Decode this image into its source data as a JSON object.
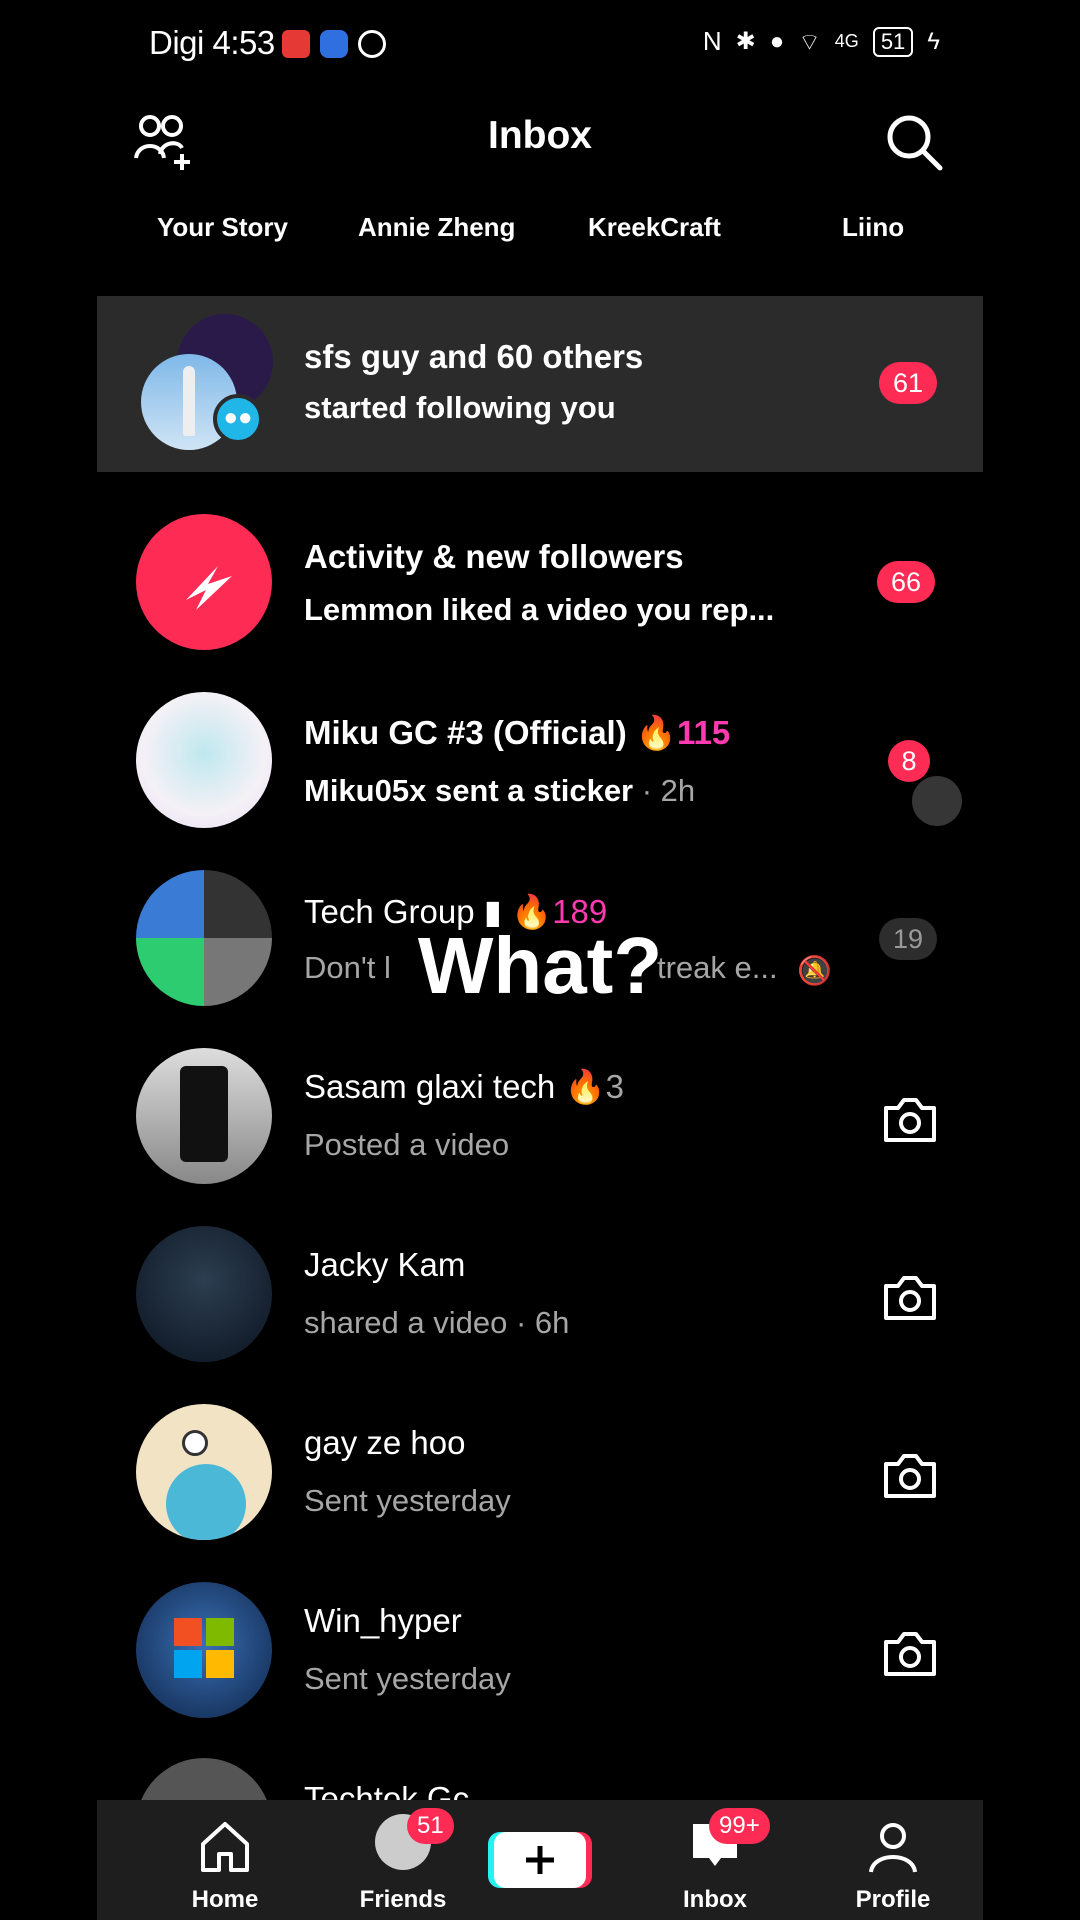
{
  "status_bar": {
    "carrier_time": "Digi 4:53",
    "network": "4G",
    "battery": "51"
  },
  "header": {
    "title": "Inbox"
  },
  "stories": [
    "Your Story",
    "Annie Zheng",
    "KreekCraft",
    "Liino"
  ],
  "rows": [
    {
      "title": "sfs guy and 60 others",
      "subtitle": "started following you",
      "badge": "61"
    },
    {
      "title": "Activity & new followers",
      "subtitle": "Lemmon liked a video you rep...",
      "badge": "66"
    },
    {
      "title": "Miku GC #3 (Official)",
      "streak": "115",
      "subtitle": "Miku05x sent a sticker",
      "time": "· 2h",
      "badge": "8"
    },
    {
      "title": "Tech Group",
      "streak": "189",
      "subtitle": "Don't l",
      "subtitle_end": "treak e...",
      "badge": "19"
    },
    {
      "title": "Sasam glaxi tech",
      "streak": "3",
      "subtitle": "Posted a video"
    },
    {
      "title": "Jacky Kam",
      "subtitle": "shared a video · 6h"
    },
    {
      "title": "gay ze hoo",
      "subtitle": "Sent yesterday"
    },
    {
      "title": "Win_hyper",
      "subtitle": "Sent yesterday"
    },
    {
      "title": "Techtok Gc"
    }
  ],
  "overlay": "What?",
  "nav": {
    "home": "Home",
    "friends": "Friends",
    "friends_badge": "51",
    "inbox": "Inbox",
    "inbox_badge": "99+",
    "profile": "Profile"
  },
  "colors": {
    "accent": "#fe2c55",
    "streak": "#ff3ab0",
    "background": "#000000"
  }
}
